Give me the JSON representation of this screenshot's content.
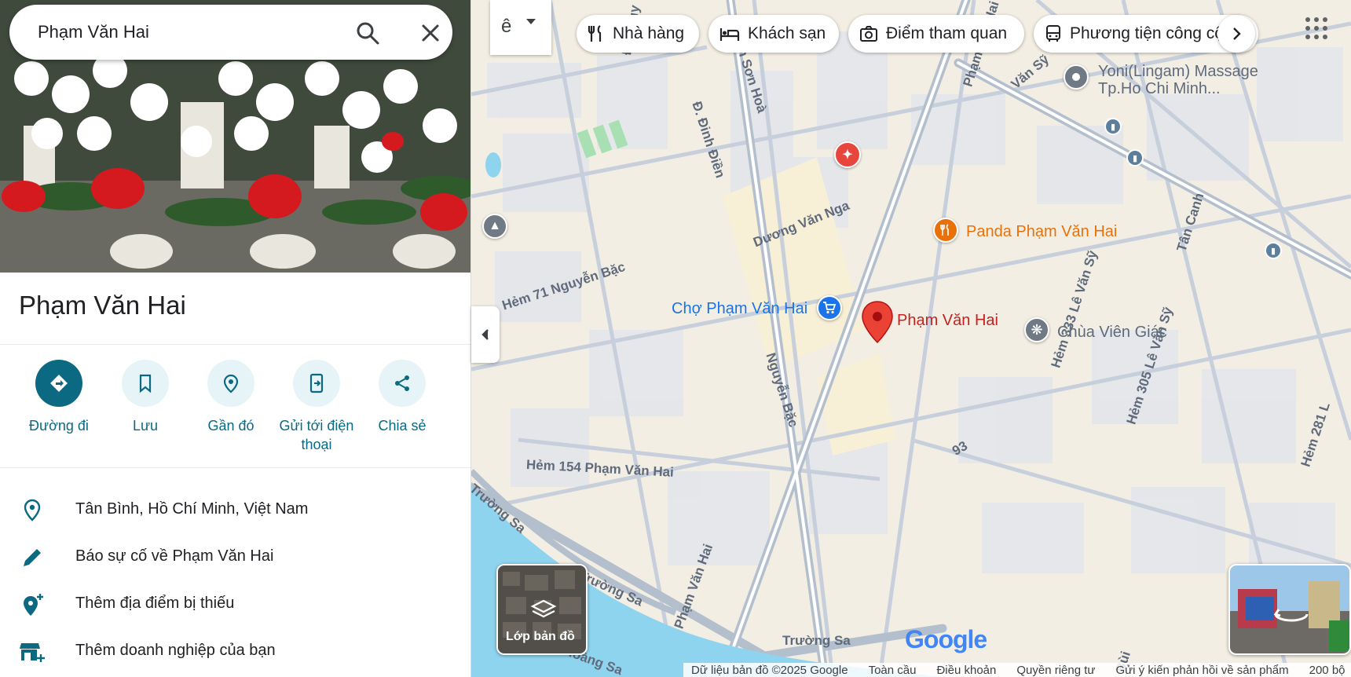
{
  "search": {
    "value": "Phạm Văn Hai"
  },
  "place": {
    "title": "Phạm Văn Hai"
  },
  "actions": [
    {
      "label": "Đường đi"
    },
    {
      "label": "Lưu"
    },
    {
      "label": "Gần đó"
    },
    {
      "label": "Gửi tới điện thoại"
    },
    {
      "label": "Chia sẻ"
    }
  ],
  "info": [
    {
      "text": "Tân Bình, Hồ Chí Minh, Việt Nam"
    },
    {
      "text": "Báo sự cố về Phạm Văn Hai"
    },
    {
      "text": "Thêm địa điểm bị thiếu"
    },
    {
      "text": "Thêm doanh nghiệp của bạn"
    }
  ],
  "map_controls": {
    "toggle_glyph": "ê"
  },
  "chips": [
    {
      "label": "Nhà hàng",
      "icon": "fork-knife-icon"
    },
    {
      "label": "Khách sạn",
      "icon": "bed-icon"
    },
    {
      "label": "Điểm tham quan",
      "icon": "camera-icon"
    },
    {
      "label": "Phương tiện công cộng",
      "icon": "bus-icon"
    }
  ],
  "map_labels": {
    "pin": "Phạm Văn Hai",
    "market": "Chợ Phạm Văn Hai",
    "restaurant": "Panda Phạm Văn Hai",
    "temple": "Chùa Viên Giác",
    "massage_1": "Yoni(Lingam) Massage",
    "massage_2": "Tp.Ho Chi Minh...",
    "streets": {
      "s1": "Phạm Văn Hai",
      "s2": "Dương Văn Nga",
      "s3": "Hẻm 71 Nguyễn Bặc",
      "s4": "Nguyễn Bặc",
      "s5": "Hẻm 154 Phạm Văn Hai",
      "s6": "Phạm Văn Hai",
      "s7": "Trường Sa",
      "s8": "Trường Sa",
      "s9": "Hoàng Sa",
      "s10": "Trường Sa",
      "s11": "Hẻm 333 Lê Văn Sỹ",
      "s12": "Hẻm 305 Lê Văn Sỹ",
      "s13": "Tân Canh",
      "s14": "Đ. Đinh Điền",
      "s15": "Văn Sỹ",
      "s16": "Ân Sơn Hoà",
      "s17": "Đ. Nguy",
      "s18": "93",
      "s19": "Hẻm 281 L",
      "s20": "Bùi"
    }
  },
  "layer": {
    "label": "Lớp bản đồ"
  },
  "google_logo": "Google",
  "footer": {
    "data": "Dữ liệu bản đồ ©2025 Google",
    "global": "Toàn cầu",
    "terms": "Điều khoản",
    "privacy": "Quyền riêng tư",
    "feedback": "Gửi ý kiến phản hồi về sản phẩm",
    "scale": "200 bộ"
  },
  "colors": {
    "accent": "#0b6a82",
    "pin": "#ea4335",
    "restaurant": "#e8710a",
    "market_blue": "#1a73e8",
    "water": "#8fd4ee"
  }
}
